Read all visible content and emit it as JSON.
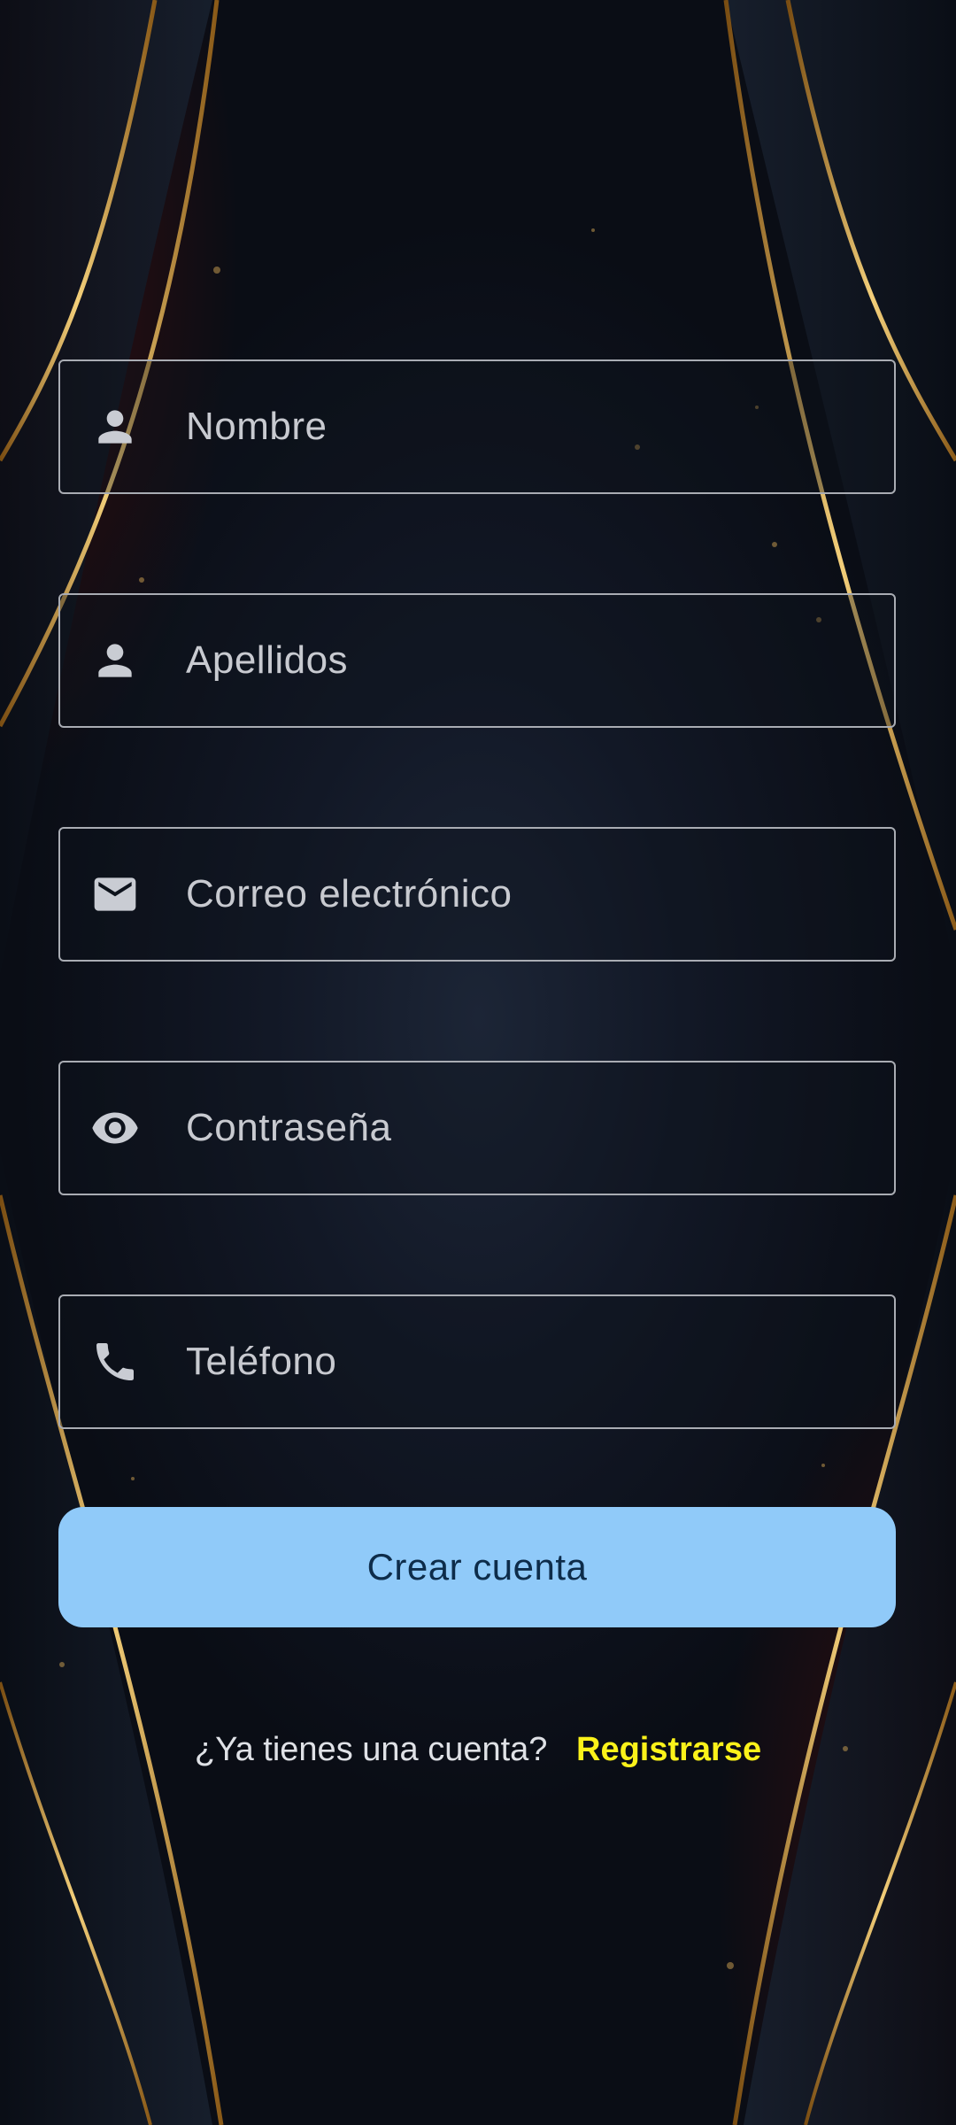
{
  "form": {
    "fields": [
      {
        "placeholder": "Nombre",
        "icon": "person-icon",
        "value": ""
      },
      {
        "placeholder": "Apellidos",
        "icon": "person-icon",
        "value": ""
      },
      {
        "placeholder": "Correo electrónico",
        "icon": "email-icon",
        "value": ""
      },
      {
        "placeholder": "Contraseña",
        "icon": "eye-icon",
        "value": ""
      },
      {
        "placeholder": "Teléfono",
        "icon": "phone-icon",
        "value": ""
      }
    ],
    "submit_label": "Crear cuenta"
  },
  "footer": {
    "question": "¿Ya tienes una cuenta?",
    "link_label": "Registrarse"
  },
  "colors": {
    "background": "#0b0f18",
    "accent_gold": "#d9a441",
    "button_bg": "#90caf9",
    "button_text": "#0d2c4a",
    "link": "#fbf21a",
    "field_border": "#a9acb3"
  }
}
